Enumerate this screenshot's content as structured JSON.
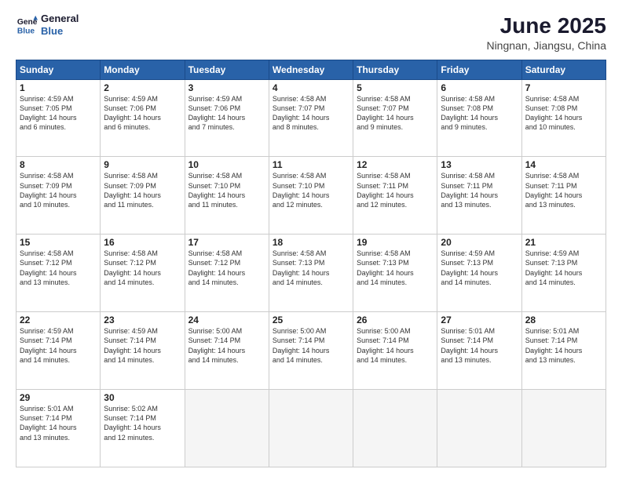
{
  "logo": {
    "line1": "General",
    "line2": "Blue"
  },
  "title": "June 2025",
  "subtitle": "Ningnan, Jiangsu, China",
  "days_of_week": [
    "Sunday",
    "Monday",
    "Tuesday",
    "Wednesday",
    "Thursday",
    "Friday",
    "Saturday"
  ],
  "weeks": [
    [
      {
        "day": 1,
        "info": "Sunrise: 4:59 AM\nSunset: 7:05 PM\nDaylight: 14 hours\nand 6 minutes."
      },
      {
        "day": 2,
        "info": "Sunrise: 4:59 AM\nSunset: 7:06 PM\nDaylight: 14 hours\nand 6 minutes."
      },
      {
        "day": 3,
        "info": "Sunrise: 4:59 AM\nSunset: 7:06 PM\nDaylight: 14 hours\nand 7 minutes."
      },
      {
        "day": 4,
        "info": "Sunrise: 4:58 AM\nSunset: 7:07 PM\nDaylight: 14 hours\nand 8 minutes."
      },
      {
        "day": 5,
        "info": "Sunrise: 4:58 AM\nSunset: 7:07 PM\nDaylight: 14 hours\nand 9 minutes."
      },
      {
        "day": 6,
        "info": "Sunrise: 4:58 AM\nSunset: 7:08 PM\nDaylight: 14 hours\nand 9 minutes."
      },
      {
        "day": 7,
        "info": "Sunrise: 4:58 AM\nSunset: 7:08 PM\nDaylight: 14 hours\nand 10 minutes."
      }
    ],
    [
      {
        "day": 8,
        "info": "Sunrise: 4:58 AM\nSunset: 7:09 PM\nDaylight: 14 hours\nand 10 minutes."
      },
      {
        "day": 9,
        "info": "Sunrise: 4:58 AM\nSunset: 7:09 PM\nDaylight: 14 hours\nand 11 minutes."
      },
      {
        "day": 10,
        "info": "Sunrise: 4:58 AM\nSunset: 7:10 PM\nDaylight: 14 hours\nand 11 minutes."
      },
      {
        "day": 11,
        "info": "Sunrise: 4:58 AM\nSunset: 7:10 PM\nDaylight: 14 hours\nand 12 minutes."
      },
      {
        "day": 12,
        "info": "Sunrise: 4:58 AM\nSunset: 7:11 PM\nDaylight: 14 hours\nand 12 minutes."
      },
      {
        "day": 13,
        "info": "Sunrise: 4:58 AM\nSunset: 7:11 PM\nDaylight: 14 hours\nand 13 minutes."
      },
      {
        "day": 14,
        "info": "Sunrise: 4:58 AM\nSunset: 7:11 PM\nDaylight: 14 hours\nand 13 minutes."
      }
    ],
    [
      {
        "day": 15,
        "info": "Sunrise: 4:58 AM\nSunset: 7:12 PM\nDaylight: 14 hours\nand 13 minutes."
      },
      {
        "day": 16,
        "info": "Sunrise: 4:58 AM\nSunset: 7:12 PM\nDaylight: 14 hours\nand 14 minutes."
      },
      {
        "day": 17,
        "info": "Sunrise: 4:58 AM\nSunset: 7:12 PM\nDaylight: 14 hours\nand 14 minutes."
      },
      {
        "day": 18,
        "info": "Sunrise: 4:58 AM\nSunset: 7:13 PM\nDaylight: 14 hours\nand 14 minutes."
      },
      {
        "day": 19,
        "info": "Sunrise: 4:58 AM\nSunset: 7:13 PM\nDaylight: 14 hours\nand 14 minutes."
      },
      {
        "day": 20,
        "info": "Sunrise: 4:59 AM\nSunset: 7:13 PM\nDaylight: 14 hours\nand 14 minutes."
      },
      {
        "day": 21,
        "info": "Sunrise: 4:59 AM\nSunset: 7:13 PM\nDaylight: 14 hours\nand 14 minutes."
      }
    ],
    [
      {
        "day": 22,
        "info": "Sunrise: 4:59 AM\nSunset: 7:14 PM\nDaylight: 14 hours\nand 14 minutes."
      },
      {
        "day": 23,
        "info": "Sunrise: 4:59 AM\nSunset: 7:14 PM\nDaylight: 14 hours\nand 14 minutes."
      },
      {
        "day": 24,
        "info": "Sunrise: 5:00 AM\nSunset: 7:14 PM\nDaylight: 14 hours\nand 14 minutes."
      },
      {
        "day": 25,
        "info": "Sunrise: 5:00 AM\nSunset: 7:14 PM\nDaylight: 14 hours\nand 14 minutes."
      },
      {
        "day": 26,
        "info": "Sunrise: 5:00 AM\nSunset: 7:14 PM\nDaylight: 14 hours\nand 14 minutes."
      },
      {
        "day": 27,
        "info": "Sunrise: 5:01 AM\nSunset: 7:14 PM\nDaylight: 14 hours\nand 13 minutes."
      },
      {
        "day": 28,
        "info": "Sunrise: 5:01 AM\nSunset: 7:14 PM\nDaylight: 14 hours\nand 13 minutes."
      }
    ],
    [
      {
        "day": 29,
        "info": "Sunrise: 5:01 AM\nSunset: 7:14 PM\nDaylight: 14 hours\nand 13 minutes."
      },
      {
        "day": 30,
        "info": "Sunrise: 5:02 AM\nSunset: 7:14 PM\nDaylight: 14 hours\nand 12 minutes."
      },
      null,
      null,
      null,
      null,
      null
    ]
  ]
}
